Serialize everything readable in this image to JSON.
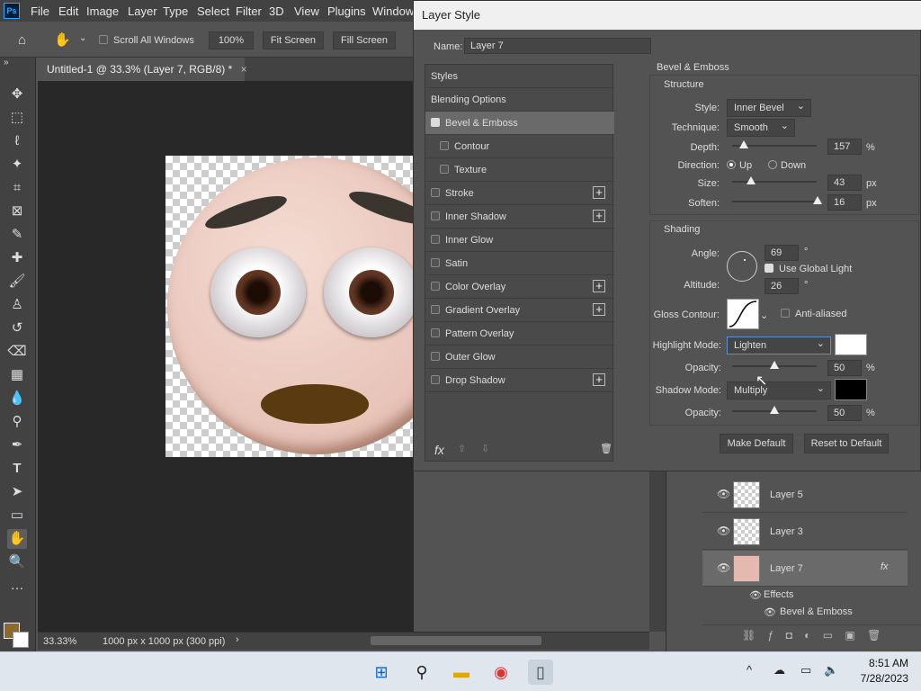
{
  "menubar": {
    "items": [
      "File",
      "Edit",
      "Image",
      "Layer",
      "Type",
      "Select",
      "Filter",
      "3D",
      "View",
      "Plugins",
      "Window"
    ],
    "logo": "Ps"
  },
  "options": {
    "scroll_all": "Scroll All Windows",
    "zoom": "100%",
    "fit": "Fit Screen",
    "fill": "Fill Screen"
  },
  "doc": {
    "tab_title": "Untitled-1 @ 33.3% (Layer 7, RGB/8) *",
    "zoom": "33.33%",
    "size": "1000 px x 1000 px (300 ppi)"
  },
  "dialog": {
    "title": "Layer Style",
    "name_label": "Name:",
    "name_value": "Layer 7",
    "styles_header": "Styles",
    "blending": "Blending Options",
    "items": [
      {
        "label": "Bevel & Emboss",
        "checked": true,
        "plus": false,
        "indent": false
      },
      {
        "label": "Contour",
        "checked": false,
        "plus": false,
        "indent": true
      },
      {
        "label": "Texture",
        "checked": false,
        "plus": false,
        "indent": true
      },
      {
        "label": "Stroke",
        "checked": false,
        "plus": true,
        "indent": false
      },
      {
        "label": "Inner Shadow",
        "checked": false,
        "plus": true,
        "indent": false
      },
      {
        "label": "Inner Glow",
        "checked": false,
        "plus": false,
        "indent": false
      },
      {
        "label": "Satin",
        "checked": false,
        "plus": false,
        "indent": false
      },
      {
        "label": "Color Overlay",
        "checked": false,
        "plus": true,
        "indent": false
      },
      {
        "label": "Gradient Overlay",
        "checked": false,
        "plus": true,
        "indent": false
      },
      {
        "label": "Pattern Overlay",
        "checked": false,
        "plus": false,
        "indent": false
      },
      {
        "label": "Outer Glow",
        "checked": false,
        "plus": false,
        "indent": false
      },
      {
        "label": "Drop Shadow",
        "checked": false,
        "plus": true,
        "indent": false
      }
    ],
    "section": "Bevel & Emboss",
    "structure": {
      "title": "Structure",
      "style_label": "Style:",
      "style": "Inner Bevel",
      "technique_label": "Technique:",
      "technique": "Smooth",
      "depth_label": "Depth:",
      "depth": "157",
      "depth_unit": "%",
      "direction_label": "Direction:",
      "up": "Up",
      "down": "Down",
      "size_label": "Size:",
      "size": "43",
      "size_unit": "px",
      "soften_label": "Soften:",
      "soften": "16",
      "soften_unit": "px"
    },
    "shading": {
      "title": "Shading",
      "angle_label": "Angle:",
      "angle": "69",
      "angle_unit": "°",
      "global_light": "Use Global Light",
      "altitude_label": "Altitude:",
      "altitude": "26",
      "altitude_unit": "°",
      "gloss_label": "Gloss Contour:",
      "antialiased": "Anti-aliased",
      "highlight_label": "Highlight Mode:",
      "highlight": "Lighten",
      "highlight_color": "#ffffff",
      "opacity_label": "Opacity:",
      "opacity1": "50",
      "opacity_unit": "%",
      "shadow_label": "Shadow Mode:",
      "shadow": "Multiply",
      "shadow_color": "#000000",
      "opacity2": "50"
    },
    "make_default": "Make Default",
    "reset_default": "Reset to Default"
  },
  "layers": {
    "rows": [
      "Layer 5",
      "Layer 3",
      "Layer 7"
    ],
    "effects": "Effects",
    "bevel": "Bevel & Emboss",
    "fx": "fx"
  },
  "taskbar": {
    "time": "8:51 AM",
    "date": "7/28/2023"
  }
}
